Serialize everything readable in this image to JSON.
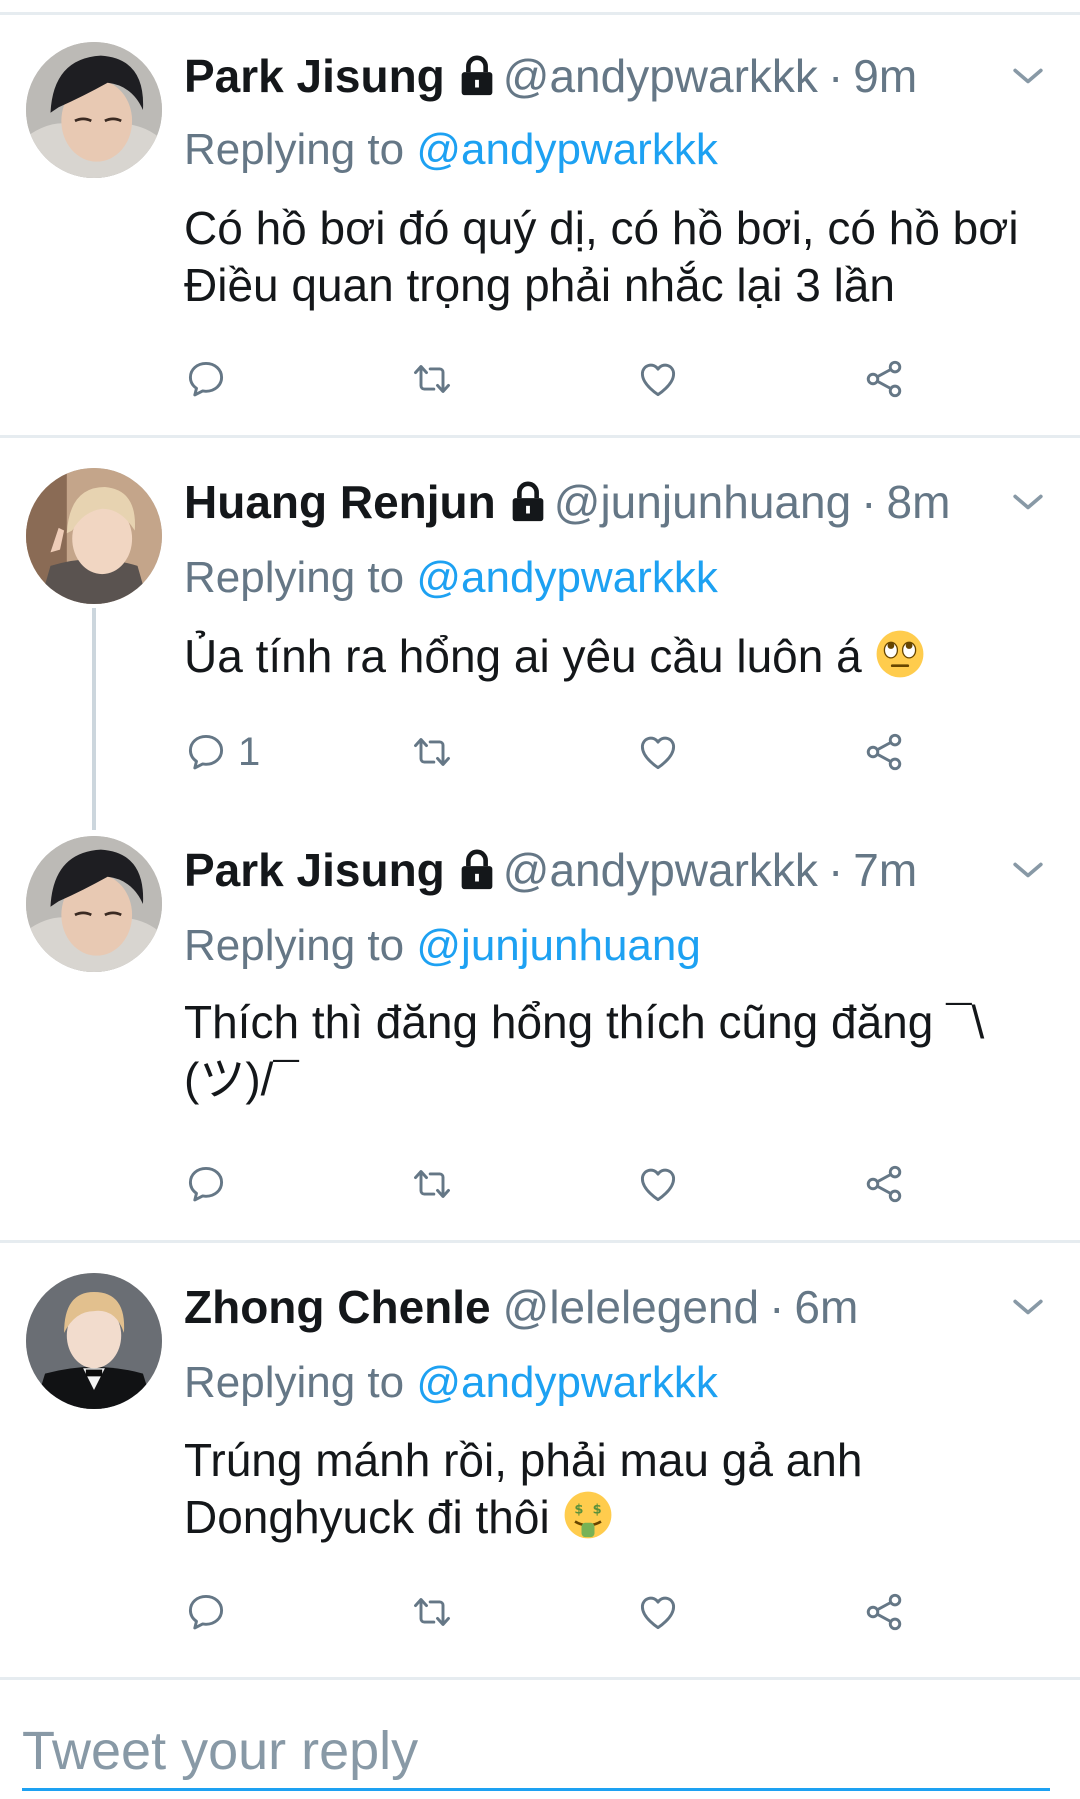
{
  "tweets": [
    {
      "name": "Park Jisung",
      "locked": true,
      "handle": "@andypwarkkk",
      "time": "9m",
      "replying_label": "Replying to",
      "replying_to": "@andypwarkkk",
      "text_lines": [
        "Có hồ bơi đó quý dị, có hồ bơi, có hồ bơi",
        "Điều quan trọng phải nhắc lại 3 lần"
      ],
      "reply_count": ""
    },
    {
      "name": "Huang Renjun",
      "locked": true,
      "handle": "@junjunhuang",
      "time": "8m",
      "replying_label": "Replying to",
      "replying_to": "@andypwarkkk",
      "text_lines": [
        "Ủa tính ra hổng ai yêu cầu luôn á"
      ],
      "emoji": "face-with-rolling-eyes",
      "reply_count": "1"
    },
    {
      "name": "Park Jisung",
      "locked": true,
      "handle": "@andypwarkkk",
      "time": "7m",
      "replying_label": "Replying to",
      "replying_to": "@junjunhuang",
      "text_lines": [
        "Thích thì đăng hổng thích cũng đăng ¯\\",
        "(ツ)/¯"
      ],
      "reply_count": ""
    },
    {
      "name": "Zhong Chenle",
      "locked": false,
      "handle": "@lelelegend",
      "time": "6m",
      "replying_label": "Replying to",
      "replying_to": "@andypwarkkk",
      "text_lines": [
        "Trúng mánh rồi, phải mau gả anh",
        "Donghyuck đi thôi"
      ],
      "emoji": "money-mouth-face",
      "reply_count": ""
    }
  ],
  "compose": {
    "placeholder": "Tweet your reply"
  },
  "colors": {
    "link": "#1da1f2",
    "muted": "#657786",
    "divider": "#e6ecf0",
    "text": "#14171a"
  },
  "icons": [
    "reply-icon",
    "retweet-icon",
    "like-icon",
    "share-icon",
    "lock-icon",
    "chevron-down-icon"
  ]
}
